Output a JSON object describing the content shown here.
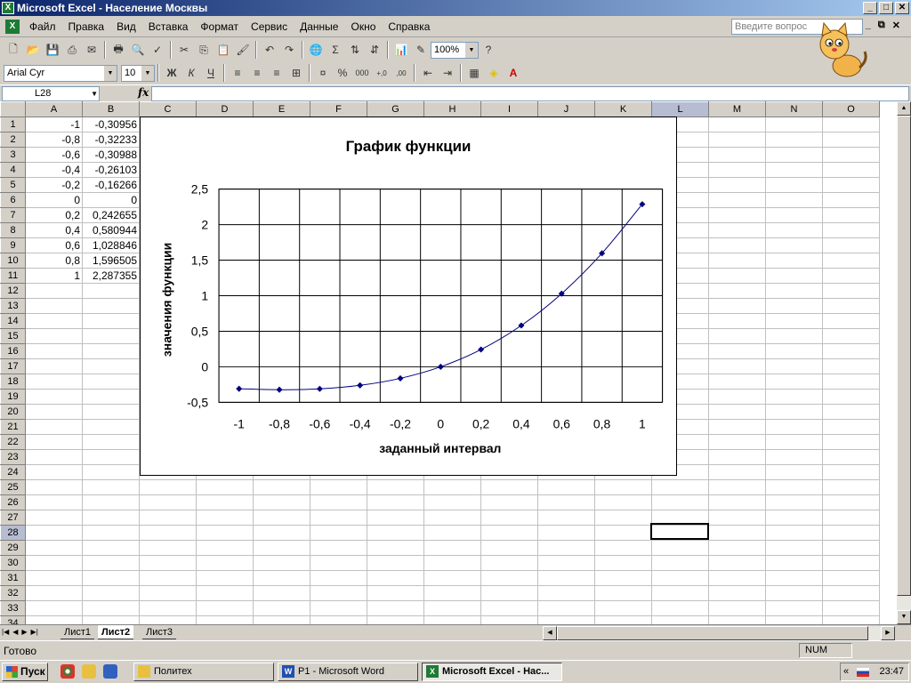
{
  "window": {
    "title": "Microsoft Excel - Население Москвы"
  },
  "menu": [
    "Файл",
    "Правка",
    "Вид",
    "Вставка",
    "Формат",
    "Сервис",
    "Данные",
    "Окно",
    "Справка"
  ],
  "help_placeholder": "Введите вопрос",
  "toolbar": {
    "zoom": "100%",
    "font_name": "Arial Cyr",
    "font_size": "10"
  },
  "formula_bar": {
    "name_box": "L28",
    "fx_label": "fx",
    "content": ""
  },
  "columns": [
    "A",
    "B",
    "C",
    "D",
    "E",
    "F",
    "G",
    "H",
    "I",
    "J",
    "K",
    "L",
    "M",
    "N",
    "O"
  ],
  "selected_column": "L",
  "selected_row": 28,
  "cells": [
    [
      "-1",
      "-0,30956"
    ],
    [
      "-0,8",
      "-0,32233"
    ],
    [
      "-0,6",
      "-0,30988"
    ],
    [
      "-0,4",
      "-0,26103"
    ],
    [
      "-0,2",
      "-0,16266"
    ],
    [
      "0",
      "0"
    ],
    [
      "0,2",
      "0,242655"
    ],
    [
      "0,4",
      "0,580944"
    ],
    [
      "0,6",
      "1,028846"
    ],
    [
      "0,8",
      "1,596505"
    ],
    [
      "1",
      "2,287355"
    ]
  ],
  "chart_data": {
    "type": "line",
    "title": "График функции",
    "xlabel": "заданный интервал",
    "ylabel": "значения функции",
    "x": [
      -1,
      -0.8,
      -0.6,
      -0.4,
      -0.2,
      0,
      0.2,
      0.4,
      0.6,
      0.8,
      1
    ],
    "x_tick_labels": [
      "-1",
      "-0,8",
      "-0,6",
      "-0,4",
      "-0,2",
      "0",
      "0,2",
      "0,4",
      "0,6",
      "0,8",
      "1"
    ],
    "y_tick_labels": [
      "-0,5",
      "0",
      "0,5",
      "1",
      "1,5",
      "2",
      "2,5"
    ],
    "y_ticks": [
      -0.5,
      0,
      0.5,
      1,
      1.5,
      2,
      2.5
    ],
    "ylim": [
      -0.5,
      2.5
    ],
    "series": [
      {
        "values": [
          -0.30956,
          -0.32233,
          -0.30988,
          -0.26103,
          -0.16266,
          0,
          0.242655,
          0.580944,
          1.028846,
          1.596505,
          2.287355
        ],
        "color": "#000080"
      }
    ],
    "grid": true,
    "legend": "none"
  },
  "sheet_tabs": [
    "Лист1",
    "Лист2",
    "Лист3"
  ],
  "active_tab": "Лист2",
  "status": {
    "ready": "Готово",
    "num": "NUM"
  },
  "taskbar": {
    "start": "Пуск",
    "tasks": [
      "Политех",
      "P1 - Microsoft Word",
      "Microsoft Excel - Нас..."
    ],
    "clock": "23:47",
    "tray_arrows": "«"
  }
}
